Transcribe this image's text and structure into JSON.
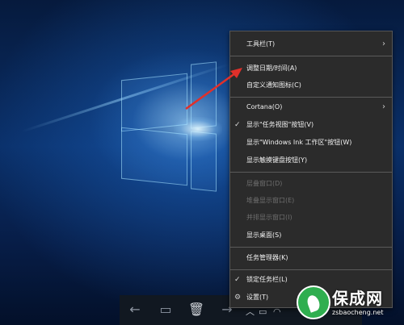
{
  "menu": {
    "items": [
      {
        "label": "工具栏(T)",
        "check": "",
        "submenu": "›"
      },
      {
        "label": "调整日期/时间(A)",
        "check": "",
        "submenu": ""
      },
      {
        "label": "自定义通知图标(C)",
        "check": "",
        "submenu": ""
      },
      {
        "label": "Cortana(O)",
        "check": "",
        "submenu": "›"
      },
      {
        "label": "显示\"任务视图\"按钮(V)",
        "check": "✓",
        "submenu": ""
      },
      {
        "label": "显示\"Windows Ink 工作区\"按钮(W)",
        "check": "",
        "submenu": ""
      },
      {
        "label": "显示触摸键盘按钮(Y)",
        "check": "",
        "submenu": ""
      },
      {
        "label": "层叠窗口(D)",
        "check": "",
        "submenu": ""
      },
      {
        "label": "堆叠显示窗口(E)",
        "check": "",
        "submenu": ""
      },
      {
        "label": "并排显示窗口(I)",
        "check": "",
        "submenu": ""
      },
      {
        "label": "显示桌面(S)",
        "check": "",
        "submenu": ""
      },
      {
        "label": "任务管理器(K)",
        "check": "",
        "submenu": ""
      },
      {
        "label": "锁定任务栏(L)",
        "check": "✓",
        "submenu": ""
      },
      {
        "label": "设置(T)",
        "check": "",
        "submenu": ""
      }
    ]
  },
  "taskbar": {
    "back_icon": "←",
    "note_icon": "▭",
    "trash_icon": "🗑",
    "forward_icon": "→",
    "tray_up": "︿",
    "tray_battery": "▭",
    "tray_wifi": "◠"
  },
  "watermark": {
    "brand": "保成网",
    "url": "zsbaocheng.net"
  },
  "colors": {
    "menu_bg": "#2b2b2b",
    "arrow": "#e0302a",
    "disabled_text": "#6e6e6e"
  }
}
